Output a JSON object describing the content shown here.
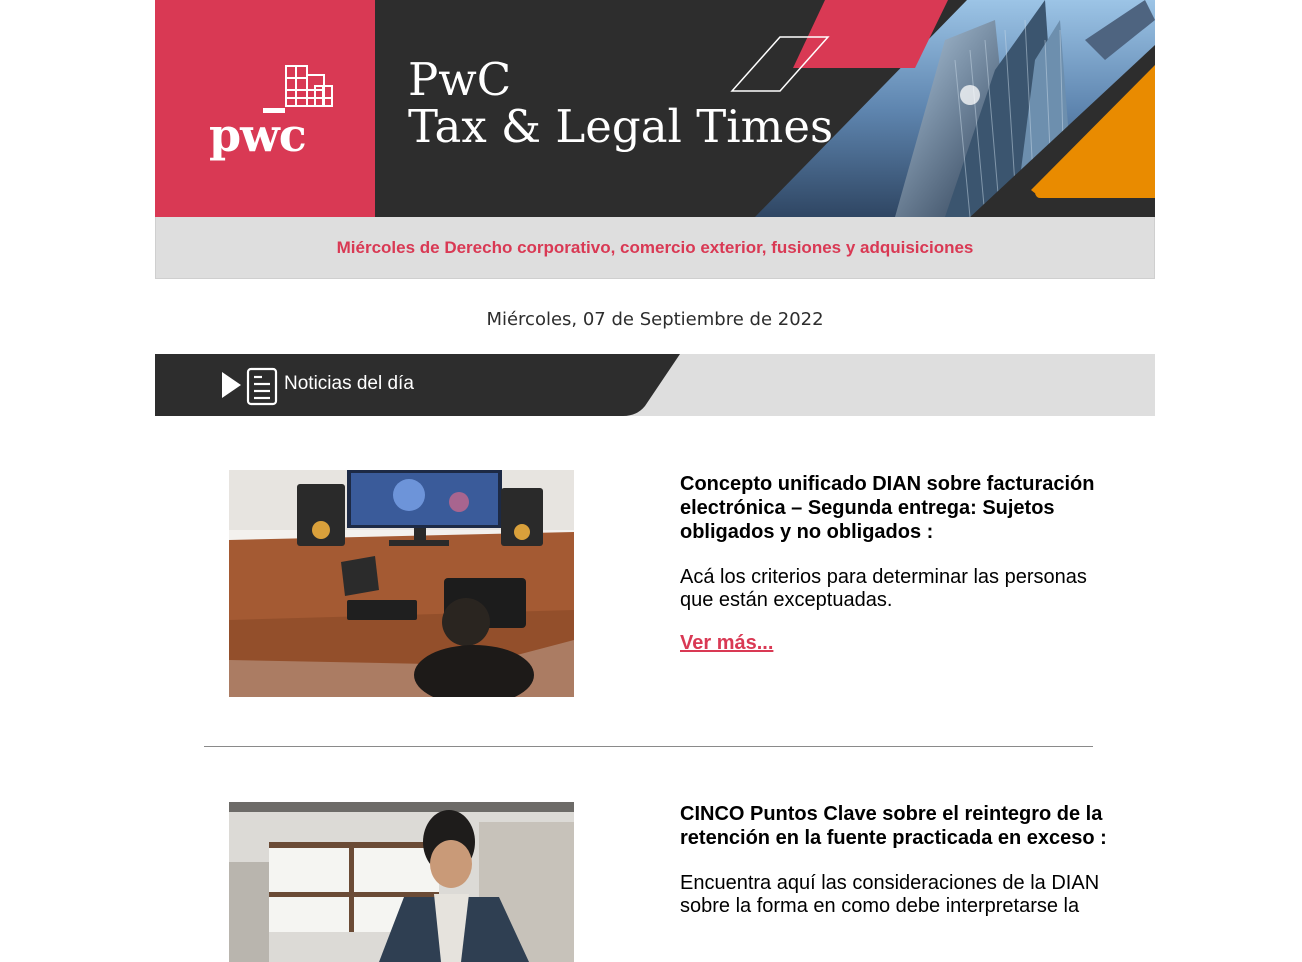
{
  "header": {
    "logo_text": "pwc",
    "title_line1": "PwC",
    "title_line2": "Tax & Legal Times"
  },
  "subheader": {
    "text": "Miércoles de Derecho corporativo, comercio exterior, fusiones y adquisiciones"
  },
  "date": "Miércoles, 07 de Septiembre de 2022",
  "section": {
    "label": "Noticias del día"
  },
  "articles": [
    {
      "headline": "Concepto unificado DIAN sobre facturación electrónica – Segunda entrega: Sujetos obligados y no obligados :",
      "summary": "Acá los criterios para determinar las personas que están exceptuadas.",
      "link": "Ver más..."
    },
    {
      "headline": "CINCO Puntos Clave sobre el reintegro de la retención en la fuente practicada en exceso :",
      "summary": "Encuentra aquí las consideraciones de la DIAN sobre la forma en como debe interpretarse la"
    }
  ],
  "colors": {
    "brand_red": "#d93954",
    "dark": "#2d2d2d",
    "orange": "#e98b00",
    "light_gray": "#dedede"
  }
}
